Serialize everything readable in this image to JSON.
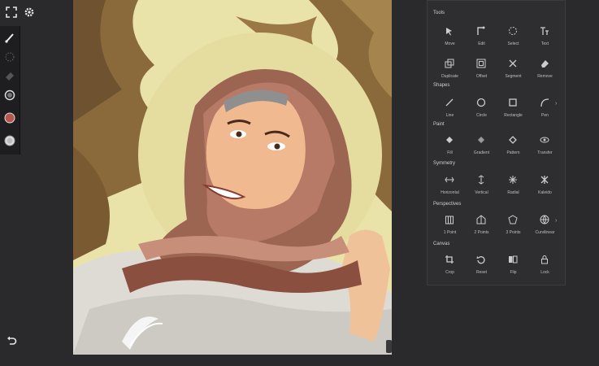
{
  "panel": {
    "sections": [
      {
        "title": "Tools",
        "items": [
          {
            "label": "Move",
            "icon": "move-icon"
          },
          {
            "label": "Edit",
            "icon": "edit-icon"
          },
          {
            "label": "Select",
            "icon": "select-icon"
          },
          {
            "label": "Text",
            "icon": "text-icon"
          },
          {
            "label": "Duplicate",
            "icon": "duplicate-icon"
          },
          {
            "label": "Offset",
            "icon": "offset-icon"
          },
          {
            "label": "Segment",
            "icon": "segment-icon"
          },
          {
            "label": "Remove",
            "icon": "remove-icon"
          }
        ]
      },
      {
        "title": "Shapes",
        "items": [
          {
            "label": "Line",
            "icon": "line-icon"
          },
          {
            "label": "Circle",
            "icon": "circle-icon"
          },
          {
            "label": "Rectangle",
            "icon": "rectangle-icon"
          },
          {
            "label": "Pen",
            "icon": "pen-icon"
          }
        ]
      },
      {
        "title": "Paint",
        "items": [
          {
            "label": "Fill",
            "icon": "fill-icon"
          },
          {
            "label": "Gradient",
            "icon": "gradient-icon"
          },
          {
            "label": "Pattern",
            "icon": "pattern-icon"
          },
          {
            "label": "Transfer",
            "icon": "transfer-icon"
          }
        ]
      },
      {
        "title": "Symmetry",
        "items": [
          {
            "label": "Horizontal",
            "icon": "horizontal-symmetry-icon"
          },
          {
            "label": "Vertical",
            "icon": "vertical-symmetry-icon"
          },
          {
            "label": "Radial",
            "icon": "radial-symmetry-icon"
          },
          {
            "label": "Kaleido",
            "icon": "kaleido-icon"
          }
        ]
      },
      {
        "title": "Perspectives",
        "items": [
          {
            "label": "1 Point",
            "icon": "one-point-icon"
          },
          {
            "label": "2 Points",
            "icon": "two-points-icon"
          },
          {
            "label": "3 Points",
            "icon": "three-points-icon"
          },
          {
            "label": "Curvilinear",
            "icon": "curvilinear-icon"
          }
        ]
      },
      {
        "title": "Canvas",
        "items": [
          {
            "label": "Crop",
            "icon": "crop-icon"
          },
          {
            "label": "Reset",
            "icon": "reset-icon"
          },
          {
            "label": "Flip",
            "icon": "flip-icon"
          },
          {
            "label": "Lock",
            "icon": "lock-icon"
          }
        ]
      }
    ]
  },
  "colors": {
    "app_bg": "#2a2a2c",
    "panel_bg": "#2e2e30",
    "active_color": "#b5574a",
    "canvas_bg": "#e9e3a9"
  }
}
